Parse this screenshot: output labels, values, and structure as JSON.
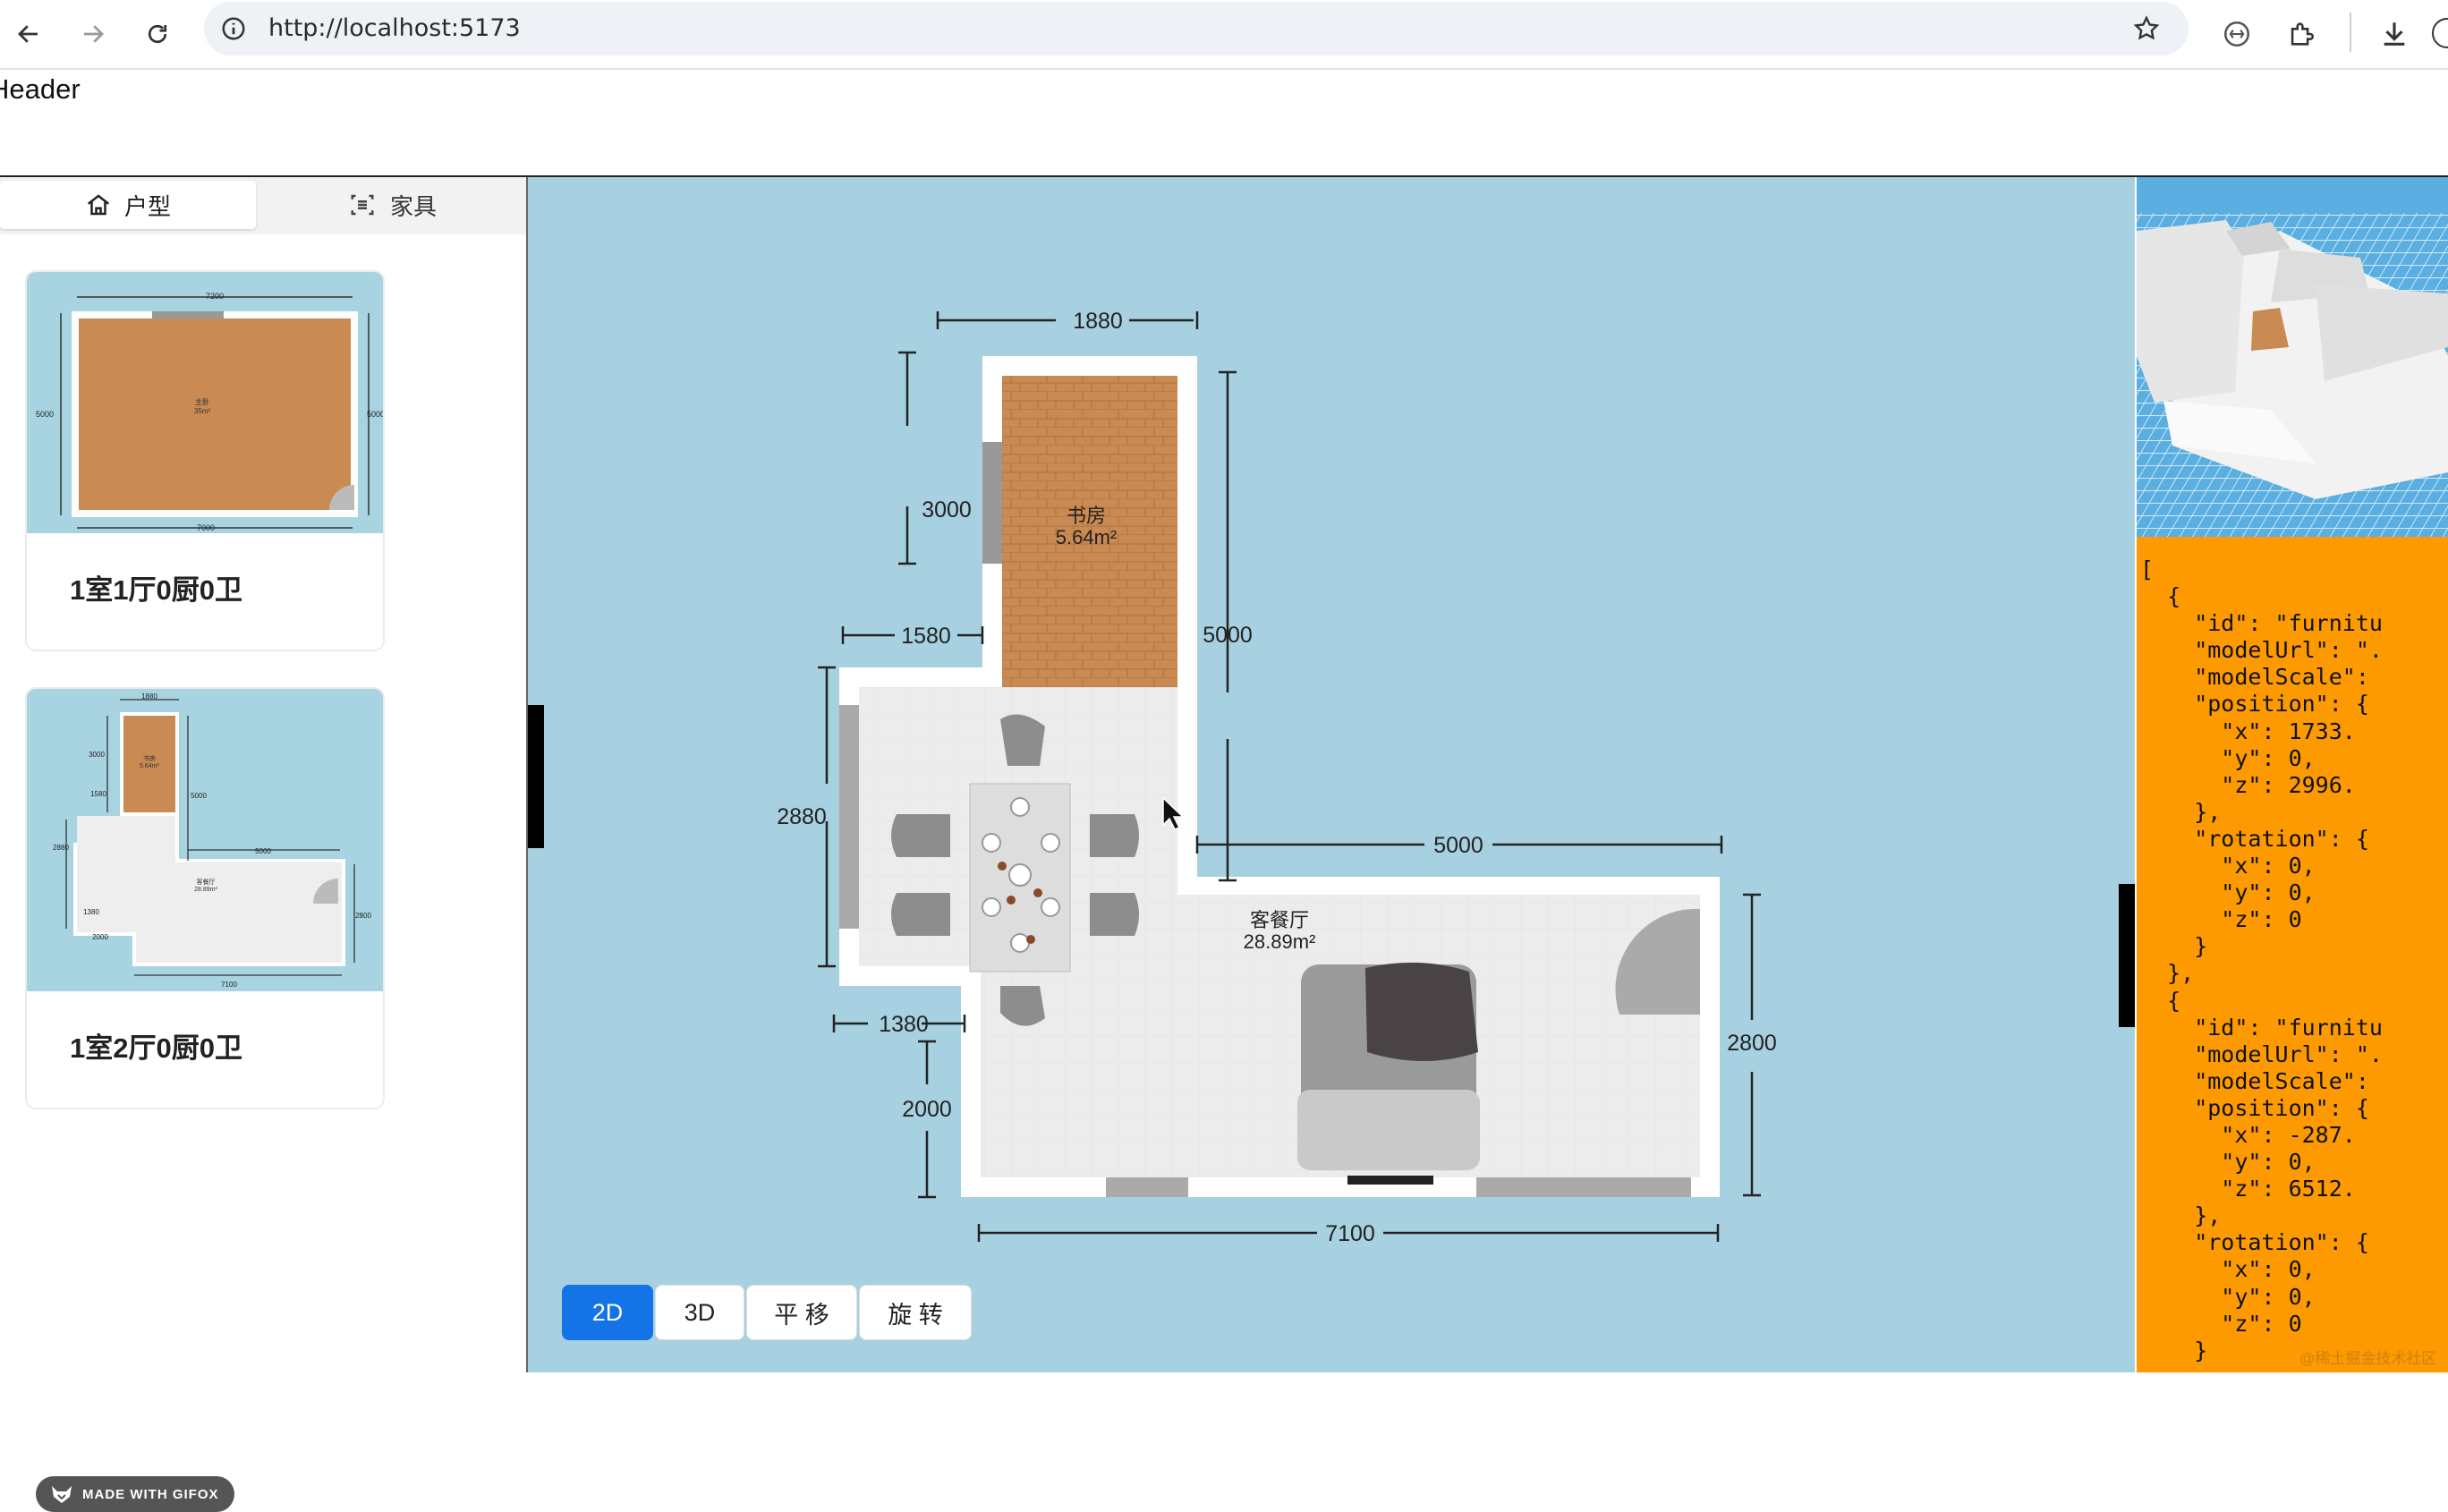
{
  "browser": {
    "url": "http://localhost:5173"
  },
  "page": {
    "header": "Header"
  },
  "left_panel": {
    "tabs": [
      {
        "label": "户型",
        "icon": "home-icon",
        "active": true
      },
      {
        "label": "家具",
        "icon": "scan-icon",
        "active": false
      }
    ],
    "cards": [
      {
        "title": "1室1厅0厨0卫",
        "dims": {
          "top": "7200",
          "bottom": "7000",
          "left": "5000",
          "right": "5000"
        },
        "room_label": "主卧",
        "room_area": "35m²"
      },
      {
        "title": "1室2厅0厨0卫",
        "dims": {
          "top": "1880",
          "a": "3000",
          "b": "5000",
          "c": "1580",
          "d": "2880",
          "e": "5000",
          "f": "1380",
          "g": "2000",
          "h": "2800",
          "bottom": "7100"
        },
        "rooms": [
          {
            "label": "书房",
            "area": "5.64m²"
          },
          {
            "label": "客餐厅",
            "area": "28.89m²"
          }
        ]
      }
    ],
    "gifox_badge": "MADE WITH GIFOX"
  },
  "canvas": {
    "dimensions": {
      "top": "1880",
      "study_height": "3000",
      "right_upper": "5000",
      "step_left": "1580",
      "left_living": "2880",
      "right_step": "5000",
      "lower_left": "1380",
      "lower_height": "2000",
      "right_lower": "2800",
      "bottom": "7100"
    },
    "rooms": [
      {
        "name": "书房",
        "area": "5.64m²"
      },
      {
        "name": "客餐厅",
        "area": "28.89m²"
      }
    ],
    "view_buttons": [
      {
        "label": "2D",
        "active": true
      },
      {
        "label": "3D",
        "active": false
      },
      {
        "label": "平 移",
        "active": false
      },
      {
        "label": "旋 转",
        "active": false
      }
    ],
    "background_color": "#a7d0e0",
    "active_button_color": "#1473e6"
  },
  "json_panel": {
    "lines": [
      "[",
      "  {",
      "    \"id\": \"furnitu",
      "    \"modelUrl\": \".",
      "    \"modelScale\": ",
      "    \"position\": {",
      "      \"x\": 1733.",
      "      \"y\": 0,",
      "      \"z\": 2996.",
      "    },",
      "    \"rotation\": {",
      "      \"x\": 0,",
      "      \"y\": 0,",
      "      \"z\": 0",
      "    }",
      "  },",
      "  {",
      "    \"id\": \"furnitu",
      "    \"modelUrl\": \".",
      "    \"modelScale\": ",
      "    \"position\": {",
      "      \"x\": -287.",
      "      \"y\": 0,",
      "      \"z\": 6512.",
      "    },",
      "    \"rotation\": {",
      "      \"x\": 0,",
      "      \"y\": 0,",
      "      \"z\": 0",
      "    }"
    ],
    "background_color": "#fd9a01"
  },
  "watermark": "@稀土掘金技术社区"
}
